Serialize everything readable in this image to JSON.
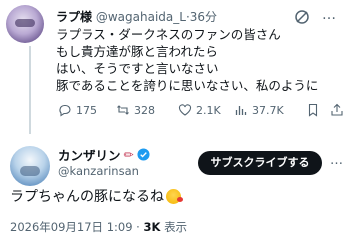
{
  "tweet1": {
    "display_name": "ラプ様",
    "handle": "@wagahaida_L",
    "separator": "·",
    "time": "36分",
    "lines": [
      "ラプラス・ダークネスのファンの皆さん",
      "もし貴方達が豚と言われたら",
      "はい、そうですと言いなさい",
      "豚であることを誇りに思いなさい、私のように"
    ],
    "replies": "175",
    "retweets": "328",
    "likes": "2.1K",
    "views": "37.7K",
    "more_icon": "…"
  },
  "tweet2": {
    "display_name": "カンザリン",
    "pencil_icon": "pencil-emoji",
    "handle": "@kanzarinsan",
    "subscribe_label": "サブスクライブする",
    "more_icon": "…",
    "text": "ラプちゃんの豚になるね",
    "emoji": "kissing-face-emoji",
    "date": "2026年09月17日 1:09",
    "dot": "·",
    "views_count": "3K",
    "views_label": "表示"
  },
  "colors": {
    "text": "#0f1419",
    "secondary": "#536471",
    "verified": "#1d9bf0",
    "button_bg": "#0f1419"
  }
}
